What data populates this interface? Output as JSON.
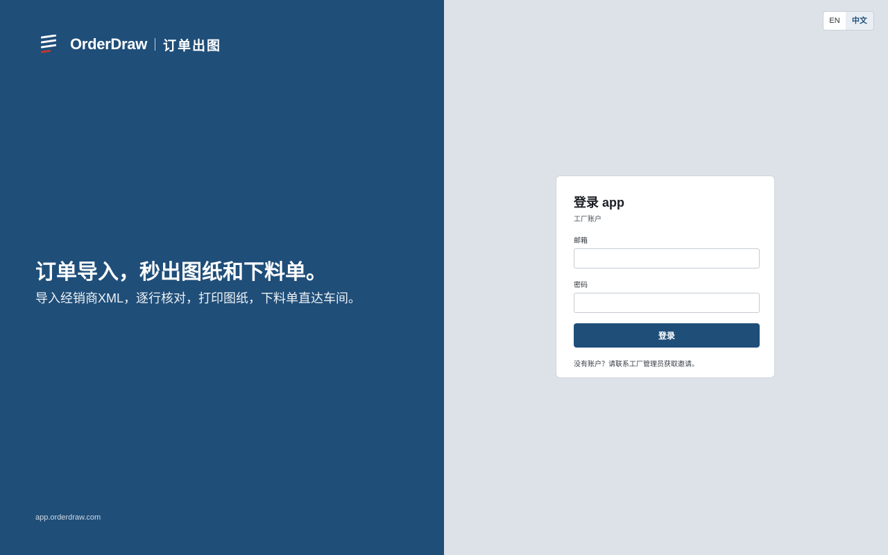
{
  "brand": {
    "name": "OrderDraw",
    "name_cn": "订单出图",
    "icon": "stacked-lines-logo-icon"
  },
  "hero": {
    "title": "订单导入，秒出图纸和下料单。",
    "subtitle": "导入经销商XML，逐行核对，打印图纸，下料单直达车间。"
  },
  "footer": {
    "domain": "app.orderdraw.com"
  },
  "lang_switch": {
    "options": [
      "EN",
      "中文"
    ],
    "selected": "中文"
  },
  "login": {
    "title": "登录 app",
    "subtitle": "工厂账户",
    "email_label": "邮箱",
    "email_value": "",
    "password_label": "密码",
    "password_value": "",
    "submit_label": "登录",
    "help": "没有账户？请联系工厂管理员获取邀请。"
  },
  "colors": {
    "brand_blue": "#1f4e79",
    "right_bg": "#dde2e8",
    "logo_accent_red": "#c0392b"
  }
}
